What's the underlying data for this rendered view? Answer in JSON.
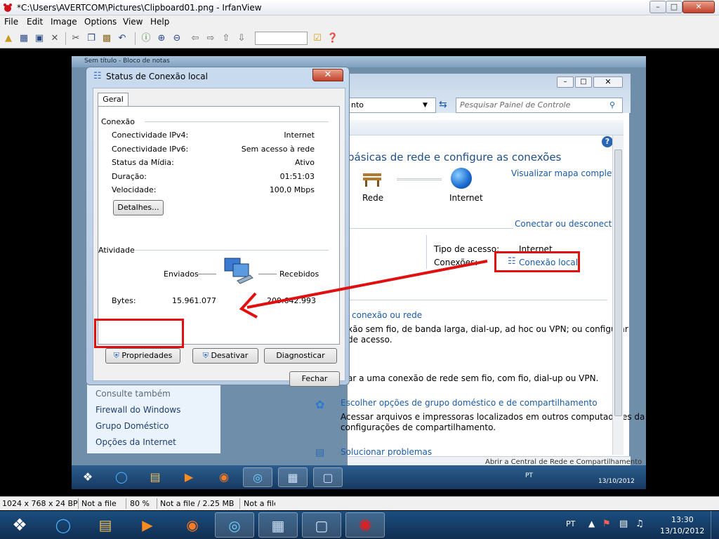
{
  "window": {
    "title": "*C:\\Users\\AVERTCOM\\Pictures\\Clipboard01.png - IrfanView",
    "minimize": "–",
    "maximize": "□",
    "close": "✕"
  },
  "menu": [
    "File",
    "Edit",
    "Image",
    "Options",
    "View",
    "Help"
  ],
  "toolbar": {
    "icons": [
      "open-folder-icon",
      "slideshow-icon",
      "save-icon",
      "delete-icon",
      "cut-icon",
      "copy-icon",
      "paste-icon",
      "undo-icon",
      "info-icon",
      "zoom-in-icon",
      "zoom-out-icon",
      "prev-icon",
      "next-icon",
      "first-icon",
      "last-icon",
      "checkmark-icon",
      "help-icon"
    ],
    "search_value": ""
  },
  "statusbar": {
    "resolution": "1024 x 768 x 24 BPP",
    "file": "Not a file",
    "zoom": "80 %",
    "filesize": "Not a file / 2.25 MB",
    "extra": "Not a file"
  },
  "taskbar": {
    "language": "PT",
    "time": "13:30",
    "date": "13/10/2012"
  },
  "inner": {
    "notepad_title": "Sem título - Bloco de notas",
    "cp": {
      "address_text": "nto",
      "search_placeholder": "Pesquisar Painel de Controle",
      "heading": "básicas de rede e configure as conexões",
      "view_full_map": "Visualizar mapa completo",
      "node_network": "Rede",
      "node_internet": "Internet",
      "connect_disconnect": "Conectar ou desconectar",
      "access_type_label": "Tipo de acesso:",
      "access_type_value": "Internet",
      "connections_label": "Conexões:",
      "connections_value": "Conexão local",
      "setup_connection_link": "conexão ou rede",
      "setup_desc1": "xão sem fio, de banda larga, dial-up, ad hoc ou VPN; ou configurar",
      "setup_desc2": "de acesso.",
      "connect_desc": "ar a uma conexão de rede sem fio, com fio, dial-up ou VPN.",
      "homegroup_link": "Escolher opções de grupo doméstico e de compartilhamento",
      "homegroup_desc1": "Acessar arquivos e impressoras localizados em outros computadores da rede ou alterar as",
      "homegroup_desc2": "configurações de compartilhamento.",
      "troubleshoot_link": "Solucionar problemas",
      "statusbar_tip": "Abrir a Central de Rede e Compartilhamento"
    },
    "cp_left": {
      "see_also": "Consulte também",
      "items": [
        "Firewall do Windows",
        "Grupo Doméstico",
        "Opções da Internet"
      ]
    },
    "dialog": {
      "title": "Status de Conexão local",
      "tab": "Geral",
      "connection_group": "Conexão",
      "rows": [
        {
          "label": "Conectividade IPv4:",
          "value": "Internet"
        },
        {
          "label": "Conectividade IPv6:",
          "value": "Sem acesso à rede"
        },
        {
          "label": "Status da Mídia:",
          "value": "Ativo"
        },
        {
          "label": "Duração:",
          "value": "01:51:03"
        },
        {
          "label": "Velocidade:",
          "value": "100,0 Mbps"
        }
      ],
      "details_button": "Detalhes...",
      "activity_group": "Atividade",
      "sent_label": "Enviados",
      "received_label": "Recebidos",
      "bytes_label": "Bytes:",
      "bytes_sent": "15.961.077",
      "bytes_received": "209.642.993",
      "properties_button": "Propriedades",
      "disable_button": "Desativar",
      "diagnose_button": "Diagnosticar",
      "close_button": "Fechar"
    },
    "taskbar": {
      "language": "PT",
      "date": "13/10/2012"
    }
  },
  "colors": {
    "accent_red": "#e01010",
    "link_blue": "#1a5aa6"
  }
}
